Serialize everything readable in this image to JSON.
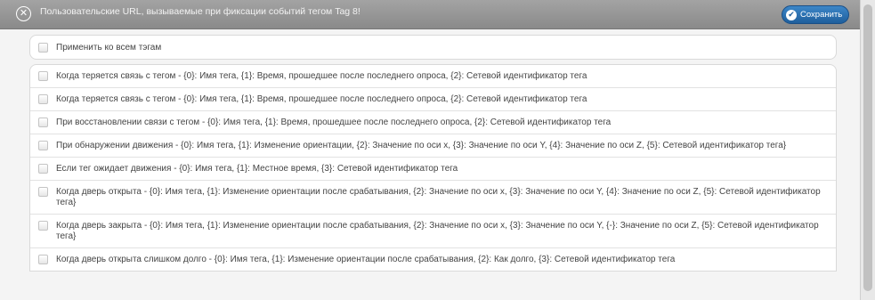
{
  "dialog": {
    "title": "Пользовательские URL, вызываемые при фиксации событий тегом Tag 8!",
    "save_label": "Сохранить"
  },
  "apply_all_label": "Применить ко всем тэгам",
  "items": [
    {
      "text": "Когда теряется связь с тегом - {0}: Имя тега, {1}: Время, прошедшее после последнего опроса, {2}: Сетевой идентификатор тега"
    },
    {
      "text": "Когда теряется связь с тегом - {0}: Имя тега, {1}: Время, прошедшее после последнего опроса, {2}: Сетевой идентификатор тега"
    },
    {
      "text": "При восстановлении связи с тегом - {0}: Имя тега, {1}: Время, прошедшее после последнего опроса, {2}: Сетевой идентификатор тега"
    },
    {
      "text": "При обнаружении движения - {0}: Имя тега, {1}: Изменение ориентации, {2}: Значение по оси x, {3}: Значение по оси Y, {4}: Значение по оси Z, {5}: Сетевой идентификатор тега}"
    },
    {
      "text": "Если тег ожидает движения - {0}: Имя тега, {1}: Местное время, {3}: Сетевой идентификатор тега"
    },
    {
      "text": "Когда дверь открыта - {0}: Имя тега, {1}: Изменение ориентации после срабатывания, {2}: Значение по оси x, {3}: Значение по оси Y, {4}: Значение по оси Z, {5}: Сетевой идентификатор тега}"
    },
    {
      "text": "Когда дверь закрыта - {0}: Имя тега, {1}: Изменение ориентации после срабатывания, {2}: Значение по оси x, {3}: Значение по оси Y, {-}: Значение по оси Z, {5}: Сетевой идентификатор тега}"
    },
    {
      "text": "Когда дверь открыта слишком долго - {0}: Имя тега, {1}: Изменение ориентации после срабатывания, {2}: Как долго, {3}: Сетевой идентификатор тега"
    }
  ]
}
